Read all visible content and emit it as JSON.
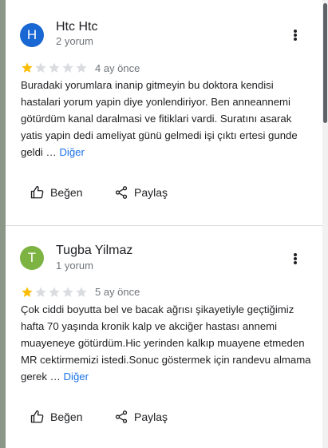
{
  "reviews": [
    {
      "avatar_letter": "H",
      "avatar_color": "#1967d2",
      "author": "Htc Htc",
      "review_count": "2 yorum",
      "rating": 1,
      "max_rating": 5,
      "date": "4 ay önce",
      "text": "Buradaki yorumlara inanip gitmeyin bu doktora kendisi hastalari yorum yapin diye yonlendiriyor. Ben anneannemi götürdüm kanal daralmasi ve fitiklari vardi. Suratını asarak yatis yapin dedi ameliyat günü gelmedi işi çıktı ertesi gunde geldi …",
      "more_label": "Diğer",
      "like_label": "Beğen",
      "share_label": "Paylaş"
    },
    {
      "avatar_letter": "T",
      "avatar_color": "#7cb342",
      "author": "Tugba Yilmaz",
      "review_count": "1 yorum",
      "rating": 1,
      "max_rating": 5,
      "date": "5 ay önce",
      "text": "Çok ciddi boyutta bel ve bacak ağrısı şikayetiyle geçtiğimiz hafta 70 yaşında kronik kalp ve akciğer hastası annemi muayeneye götürdüm.Hic yerinden kalkıp muayene etmeden MR cektirmemizi istedi.Sonuc göstermek için randevu almama gerek …",
      "more_label": "Diğer",
      "like_label": "Beğen",
      "share_label": "Paylaş"
    }
  ],
  "colors": {
    "star_filled": "#fbbc04",
    "star_empty": "#dadce0",
    "link": "#1a73e8",
    "text": "#202124",
    "secondary_text": "#70757a",
    "background_outside": "#8c9688"
  },
  "icons": {
    "menu": "more-vert-icon",
    "like": "thumb-up-icon",
    "share": "share-icon",
    "star": "star-icon"
  }
}
